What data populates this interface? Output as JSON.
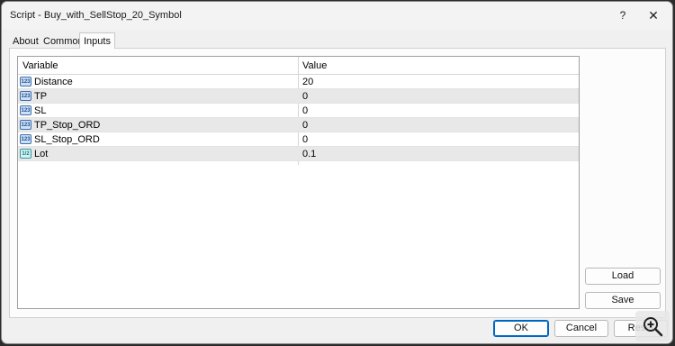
{
  "window": {
    "title": "Script - Buy_with_SellStop_20_Symbol",
    "help_label": "?",
    "close_label": "✕"
  },
  "tabs": [
    {
      "label": "About"
    },
    {
      "label": "Common"
    },
    {
      "label": "Inputs",
      "active": true
    }
  ],
  "grid": {
    "headers": {
      "variable": "Variable",
      "value": "Value"
    },
    "rows": [
      {
        "name": "Distance",
        "value": "20",
        "type_icon": "integer-icon",
        "icon_text": "123"
      },
      {
        "name": "TP",
        "value": "0",
        "type_icon": "integer-icon",
        "icon_text": "123"
      },
      {
        "name": "SL",
        "value": "0",
        "type_icon": "integer-icon",
        "icon_text": "123"
      },
      {
        "name": "TP_Stop_ORD",
        "value": "0",
        "type_icon": "integer-icon",
        "icon_text": "123"
      },
      {
        "name": "SL_Stop_ORD",
        "value": "0",
        "type_icon": "integer-icon",
        "icon_text": "123"
      },
      {
        "name": "Lot",
        "value": "0.1",
        "type_icon": "double-icon",
        "icon_text": "1/2"
      }
    ]
  },
  "side_buttons": {
    "load": "Load",
    "save": "Save"
  },
  "footer_buttons": {
    "ok": "OK",
    "cancel": "Cancel",
    "reset": "Reset"
  },
  "overlay": {
    "icon": "zoom-in-icon"
  },
  "colors": {
    "accent": "#0067c0",
    "alt_row": "#e8e8e8"
  }
}
